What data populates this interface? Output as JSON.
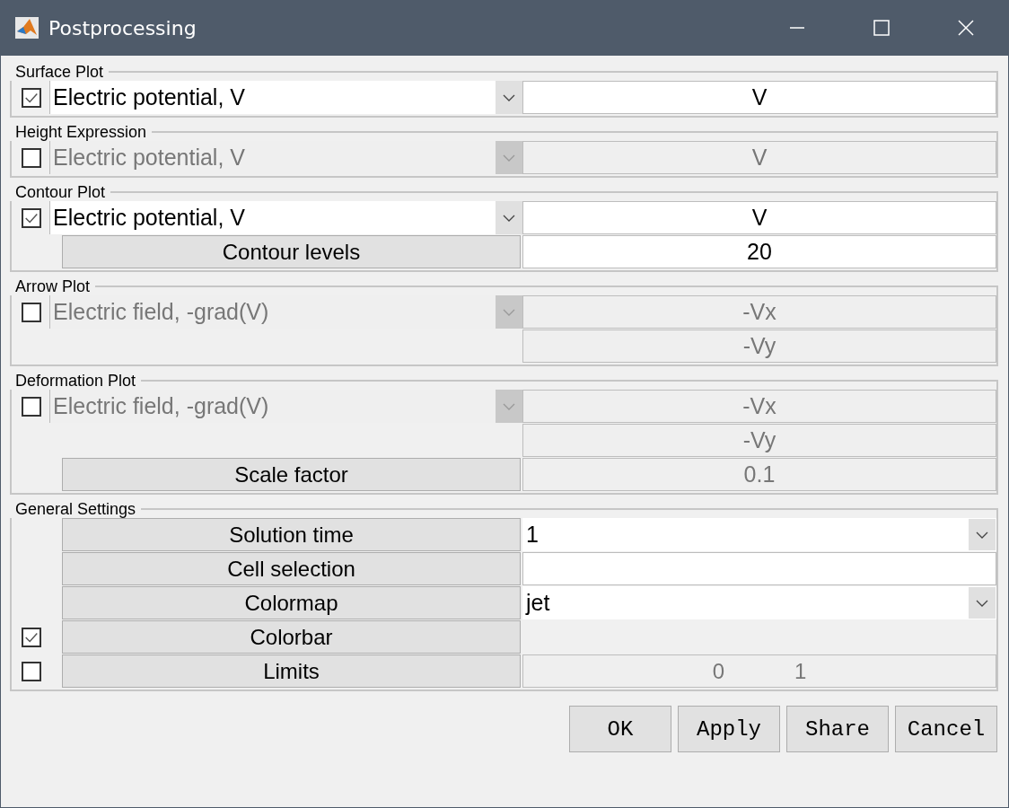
{
  "window": {
    "title": "Postprocessing"
  },
  "sections": [
    {
      "title": "Surface Plot",
      "rows": [
        {
          "checkbox": {
            "checked": true
          },
          "left": {
            "kind": "dropdown",
            "text": "Electric potential, V",
            "disabled": false
          },
          "right": {
            "kind": "field",
            "text": "V",
            "disabled": false
          }
        }
      ]
    },
    {
      "title": "Height Expression",
      "rows": [
        {
          "checkbox": {
            "checked": false
          },
          "left": {
            "kind": "dropdown",
            "text": "Electric potential, V",
            "disabled": true
          },
          "right": {
            "kind": "field",
            "text": "V",
            "disabled": true
          }
        }
      ]
    },
    {
      "title": "Contour Plot",
      "rows": [
        {
          "checkbox": {
            "checked": true
          },
          "left": {
            "kind": "dropdown",
            "text": "Electric potential, V",
            "disabled": false
          },
          "right": {
            "kind": "field",
            "text": "V",
            "disabled": false
          }
        },
        {
          "left": {
            "kind": "label",
            "text": "Contour levels"
          },
          "right": {
            "kind": "field",
            "text": "20",
            "disabled": false
          }
        }
      ]
    },
    {
      "title": "Arrow Plot",
      "rows": [
        {
          "checkbox": {
            "checked": false
          },
          "left": {
            "kind": "dropdown",
            "text": "Electric field, -grad(V)",
            "disabled": true
          },
          "right": {
            "kind": "field",
            "text": "-Vx",
            "disabled": true
          }
        },
        {
          "right": {
            "kind": "field",
            "text": "-Vy",
            "disabled": true
          }
        }
      ]
    },
    {
      "title": "Deformation Plot",
      "rows": [
        {
          "checkbox": {
            "checked": false
          },
          "left": {
            "kind": "dropdown",
            "text": "Electric field, -grad(V)",
            "disabled": true
          },
          "right": {
            "kind": "field",
            "text": "-Vx",
            "disabled": true
          }
        },
        {
          "right": {
            "kind": "field",
            "text": "-Vy",
            "disabled": true
          }
        },
        {
          "left": {
            "kind": "label",
            "text": "Scale factor"
          },
          "right": {
            "kind": "field",
            "text": "0.1",
            "disabled": true
          }
        }
      ]
    },
    {
      "title": "General Settings",
      "rows": [
        {
          "left": {
            "kind": "label",
            "text": "Solution time"
          },
          "right": {
            "kind": "dropdown",
            "text": "1",
            "disabled": false
          }
        },
        {
          "left": {
            "kind": "label",
            "text": "Cell selection"
          },
          "right": {
            "kind": "field",
            "disabled": false
          }
        },
        {
          "left": {
            "kind": "label",
            "text": "Colormap"
          },
          "right": {
            "kind": "dropdown",
            "text": "jet",
            "disabled": false
          }
        },
        {
          "checkbox": {
            "checked": true
          },
          "left": {
            "kind": "label",
            "text": "Colorbar"
          }
        },
        {
          "checkbox": {
            "checked": false
          },
          "left": {
            "kind": "label",
            "text": "Limits"
          },
          "right": {
            "kind": "pair",
            "values": [
              "0",
              "1"
            ],
            "disabled": true
          }
        }
      ]
    }
  ],
  "buttons": [
    "OK",
    "Apply",
    "Share",
    "Cancel"
  ]
}
